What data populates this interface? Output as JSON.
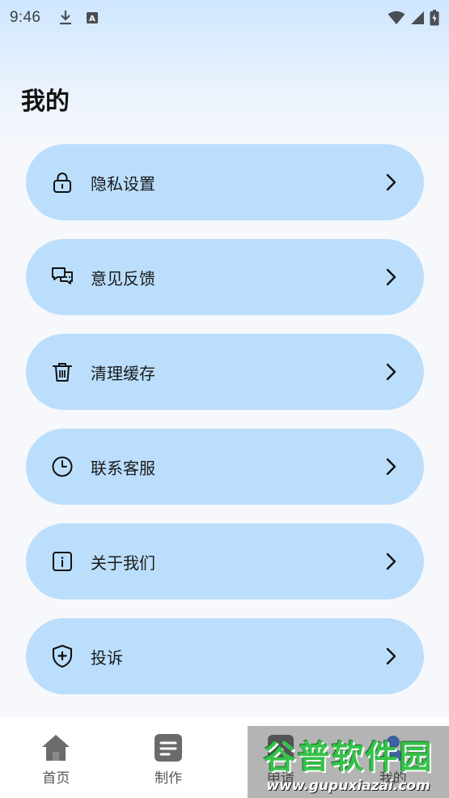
{
  "status_bar": {
    "time": "9:46",
    "icons": [
      "download-icon",
      "keyboard-a-icon",
      "wifi-icon",
      "signal-icon",
      "battery-icon"
    ]
  },
  "page": {
    "title": "我的"
  },
  "menu": {
    "items": [
      {
        "label": "隐私设置",
        "icon": "lock-icon"
      },
      {
        "label": "意见反馈",
        "icon": "chat-icon"
      },
      {
        "label": "清理缓存",
        "icon": "trash-icon"
      },
      {
        "label": "联系客服",
        "icon": "clock-icon"
      },
      {
        "label": "关于我们",
        "icon": "info-icon"
      },
      {
        "label": "投诉",
        "icon": "shield-plus-icon"
      }
    ]
  },
  "bottom_nav": {
    "items": [
      {
        "label": "首页",
        "icon": "home-icon"
      },
      {
        "label": "制作",
        "icon": "document-icon"
      },
      {
        "label": "申请",
        "icon": "apply-icon"
      },
      {
        "label": "我的",
        "icon": "profile-icon"
      }
    ]
  },
  "watermark": {
    "title": "谷普软件园",
    "url": "www.gupuxiazai.com"
  },
  "colors": {
    "card_bg": "#bbdefc",
    "header_gradient_top": "#cfe6ff",
    "page_bg": "#f7f8fb",
    "nav_icon": "#6b6b6b"
  }
}
